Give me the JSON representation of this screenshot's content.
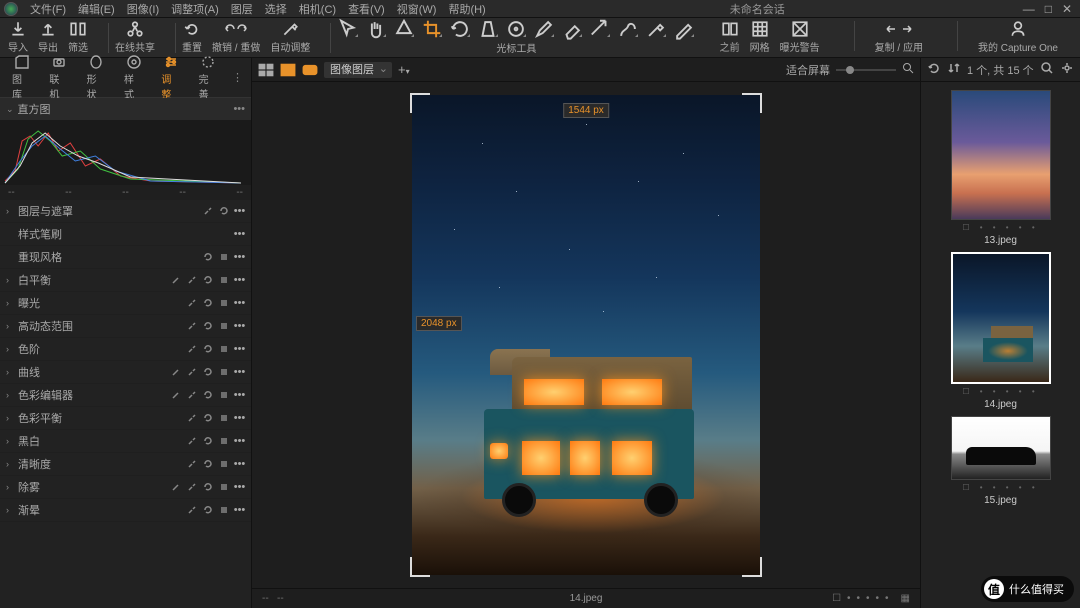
{
  "window": {
    "title": "未命名会话"
  },
  "menu": [
    "文件(F)",
    "编辑(E)",
    "图像(I)",
    "调整项(A)",
    "图层",
    "选择",
    "相机(C)",
    "查看(V)",
    "视窗(W)",
    "帮助(H)"
  ],
  "toolbar": {
    "import": "导入",
    "export": "导出",
    "exclude": "筛选",
    "online_share": "在线共享",
    "reset": "重置",
    "undo_redo": "撤销 / 重做",
    "auto_adjust": "自动调整",
    "cursor_label": "光标工具",
    "before": "之前",
    "grid": "网格",
    "exposure_warning": "曝光警告",
    "copy_apply": "复制 / 应用",
    "my_capture_one": "我的 Capture One"
  },
  "left_tabs": {
    "library": "图库",
    "tether": "联机",
    "shape": "形状",
    "style": "样式",
    "adjust": "调整",
    "refine": "完善"
  },
  "sections": {
    "histogram": "直方图",
    "layers": "图层与遮罩",
    "style_brush": "样式笔刷",
    "reproduce": "重现风格",
    "white_balance": "白平衡",
    "exposure": "曝光",
    "hdr": "高动态范围",
    "levels": "色阶",
    "curves": "曲线",
    "color_editor": "色彩编辑器",
    "color_balance": "色彩平衡",
    "bw": "黑白",
    "clarity": "清晰度",
    "dehaze": "除雾",
    "vignette": "渐晕"
  },
  "histo_footer": [
    "--",
    "--",
    "--",
    "--",
    "--"
  ],
  "viewer": {
    "layer_select": "图像图层",
    "zoom_label": "适合屏幕",
    "width_px": "1544 px",
    "height_px": "2048 px",
    "filename": "14.jpeg"
  },
  "browser": {
    "count": "1 个, 共 15 个",
    "thumbs": [
      {
        "name": "13.jpeg"
      },
      {
        "name": "14.jpeg"
      },
      {
        "name": "15.jpeg"
      }
    ]
  },
  "watermark": "什么值得买",
  "colors": {
    "accent": "#e8922a"
  }
}
